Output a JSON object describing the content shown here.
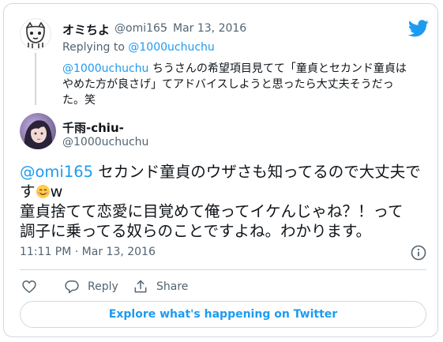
{
  "quoted_tweet": {
    "name": "オミちよ",
    "handle": "@omi165",
    "separator": "·",
    "date": "Mar 13, 2016",
    "replying_prefix": "Replying to ",
    "replying_to": "@1000uchuchu",
    "mention": "@1000uchuchu",
    "text_line1": " ちうさんの希望項目見てて「童貞とセカンド童貞は",
    "text_line2": "やめた方が良さげ」てアドバイスしようと思ったら大丈夫そうだっ",
    "text_line3": "た。笑"
  },
  "main_tweet": {
    "name": "千雨-chiu-",
    "handle": "@1000uchuchu",
    "mention": "@omi165",
    "text_part1": " セカンド童貞のウザさも知ってるので大丈夫で",
    "text_part2": "す",
    "text_part3": "w",
    "text_line3": "童貞捨てて恋愛に目覚めて俺ってイケんじゃね？！って",
    "text_line4": "調子に乗ってる奴らのことですよね。わかります。",
    "emoji_icon": "smiling-face-with-hearts-emoji",
    "timestamp": "11:11 PM · Mar 13, 2016"
  },
  "actions": {
    "like_icon": "heart-icon",
    "reply_icon": "speech-bubble-icon",
    "reply_label": "Reply",
    "share_icon": "share-icon",
    "share_label": "Share"
  },
  "explore_label": "Explore what's happening on Twitter",
  "colors": {
    "link": "#1d9bf0",
    "muted": "#536471",
    "border": "#cfd9de",
    "text": "#0f1419"
  }
}
